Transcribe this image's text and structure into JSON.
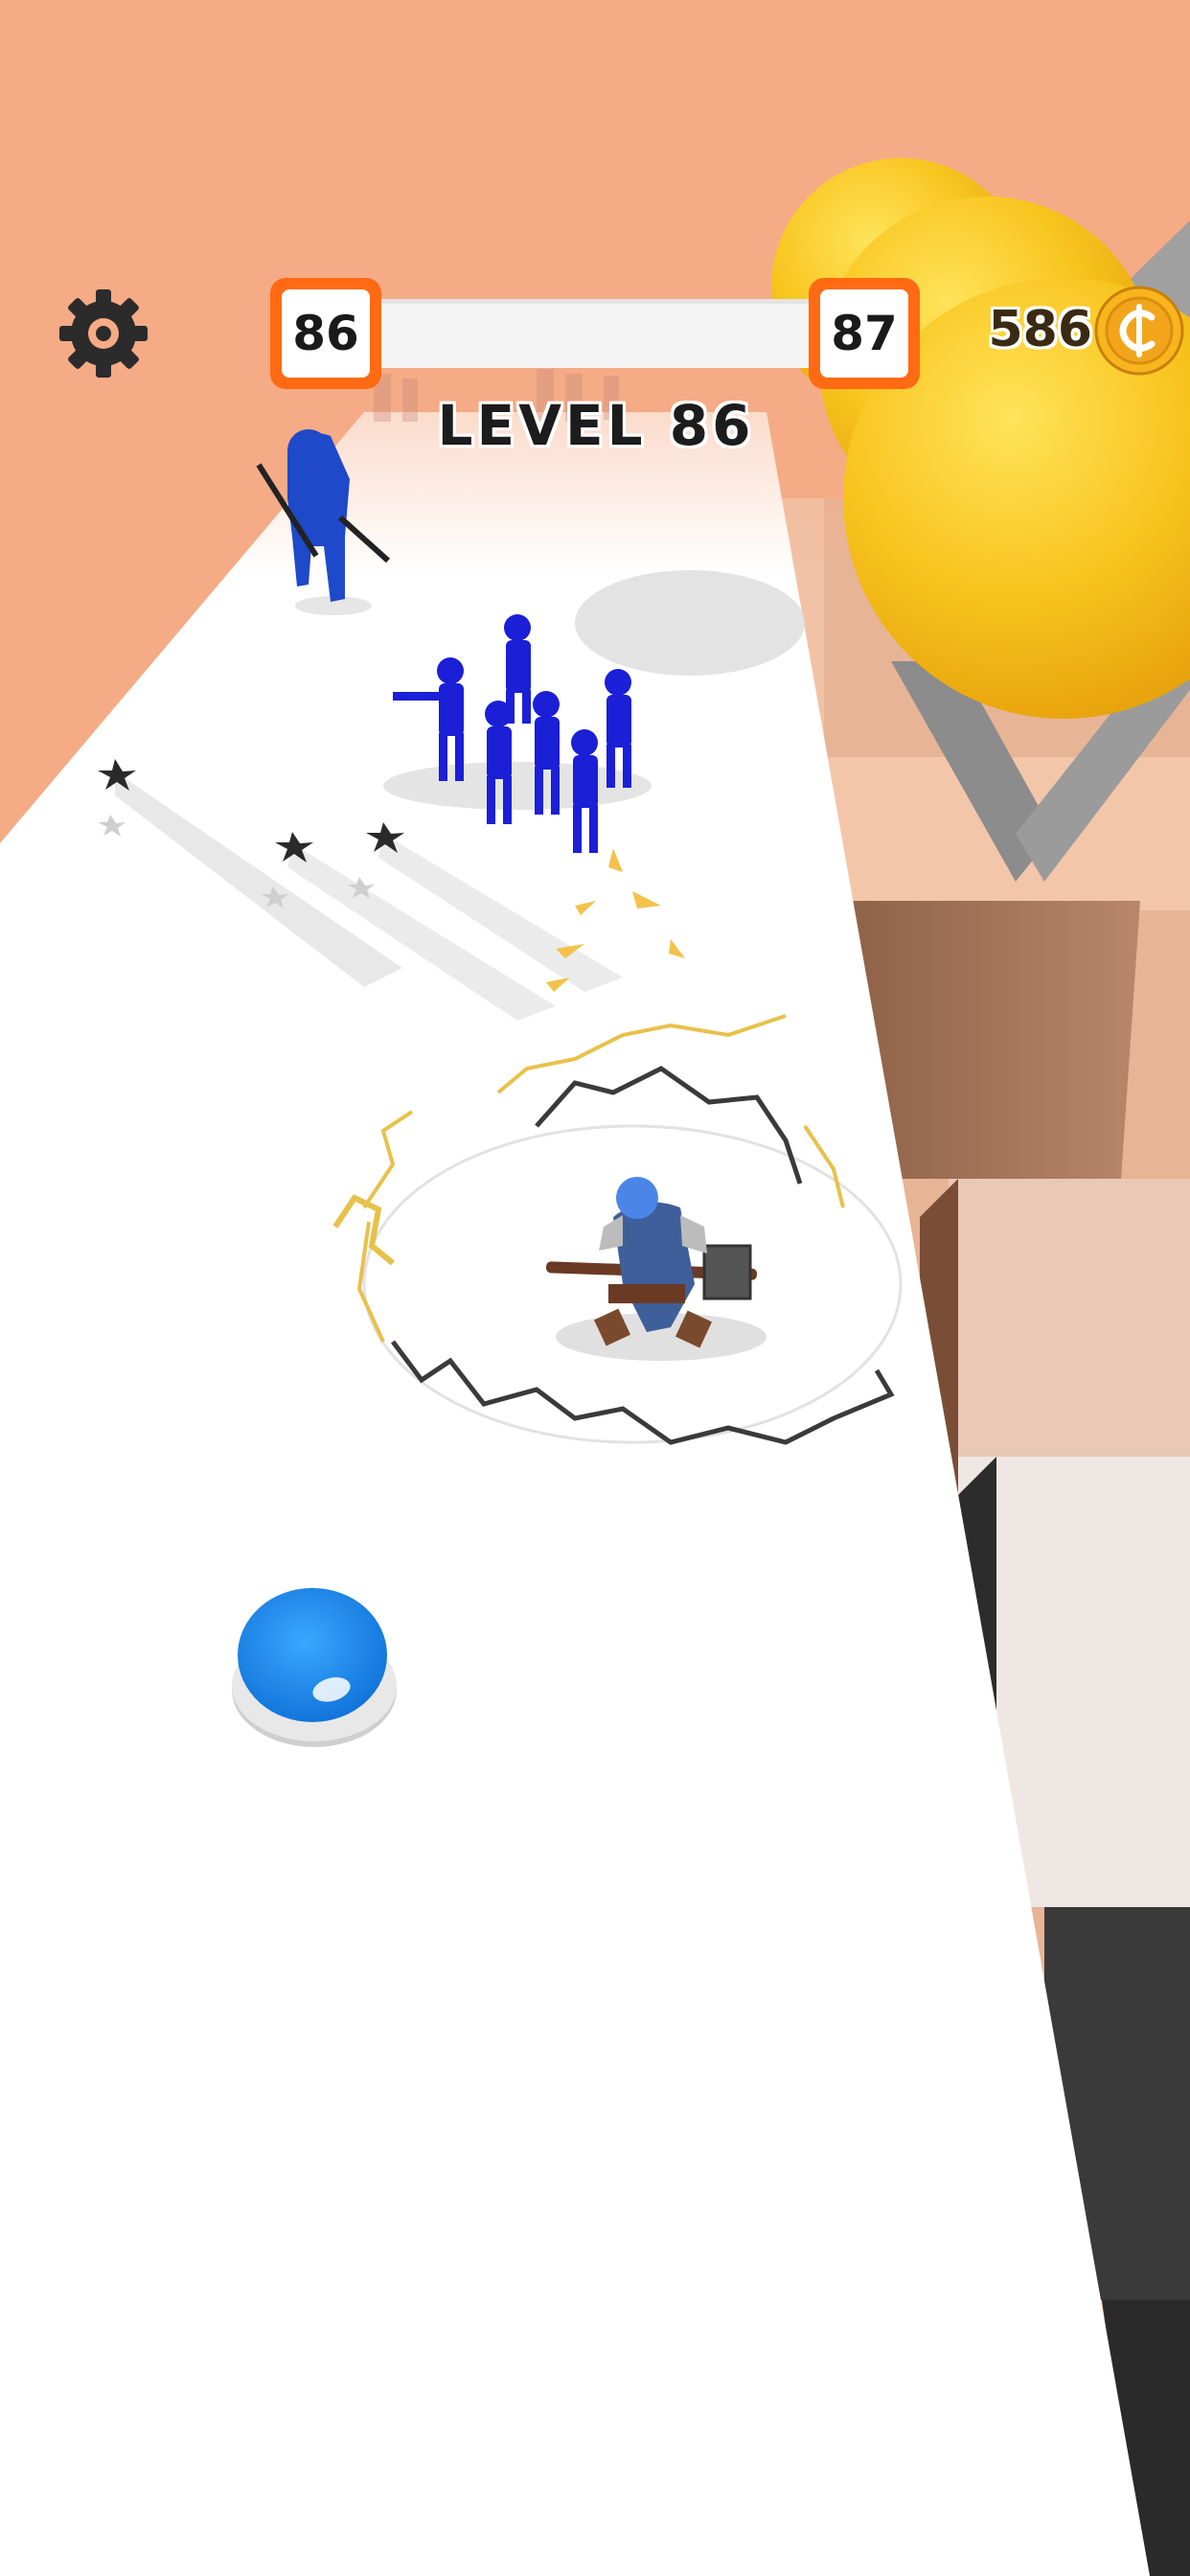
{
  "hud": {
    "settings_icon": "gear-icon",
    "current_level": "86",
    "next_level": "87",
    "level_progress": 0.0,
    "level_title": "LEVEL 86",
    "coin_count": "586",
    "coin_icon": "coin-icon"
  },
  "colors": {
    "background": "#f5ab85",
    "track": "#ffffff",
    "accent_orange": "#ff6a13",
    "enemy_blue": "#1b1fd6",
    "hero_blue": "#2f6fd8",
    "ball_yellow": "#f7c21c",
    "button_blue": "#1a8ef0",
    "coin_gold": "#f2a51b"
  },
  "game": {
    "joystick_icon": "blue-circle-button"
  }
}
